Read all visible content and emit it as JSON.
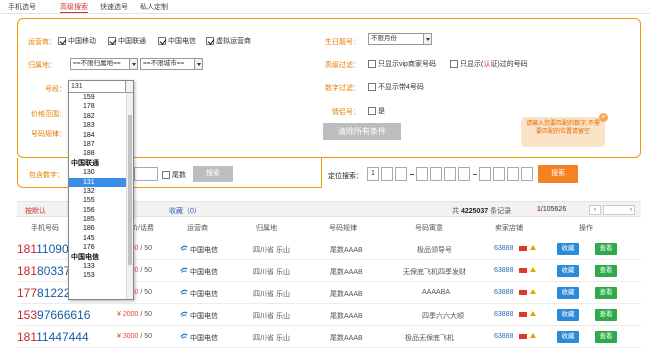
{
  "topnav": {
    "tabs": [
      "手机选号",
      "高级搜索",
      "快速选号",
      "私人定制"
    ]
  },
  "search": {
    "carrier_label": "运营商：",
    "carriers": [
      "中国移动",
      "中国联通",
      "中国电信",
      "虚拟运营商"
    ],
    "region_label": "归属地：",
    "province_placeholder": "==不限归属地==",
    "city_placeholder": "==不限城市==",
    "segment_label": "号段：",
    "segment_value": "131",
    "price_label": "价格范围：",
    "rule_label": "号码规律：",
    "birthday_label": "生日靓号：",
    "birthday_value": "不限月份",
    "advanced_label": "高级过滤：",
    "filter_vip": "只显示vip商家号码",
    "filter_cert_pre": "只显示(",
    "filter_cert_mid": "认",
    "filter_cert_post": "证)过的号码",
    "digit_label": "数字过滤：",
    "filter_no4": "不显示带4号码",
    "lovers_label": "情侣号：",
    "lovers_yes": "是",
    "clear_button": "清除所有条件",
    "tip_text": "请输入您要匹配的数字,不需要匹配的位置请留空",
    "contains_label": "包含数字：",
    "tail_label": "尾数",
    "search_button": "搜索",
    "position_label": "定位搜索：",
    "position_first": "1",
    "position_search_button": "搜索"
  },
  "sortbar": {
    "default_label": "按默认",
    "favorites": "收藏（0）",
    "total_prefix": "共",
    "total": "4225037",
    "total_suffix": "条记录",
    "page_current": "1",
    "page_total": "/105626"
  },
  "table": {
    "headers": [
      "手机号码",
      "售价/话费",
      "运营商",
      "归属地",
      "号码规律",
      "号码寓意",
      "卖家店铺",
      "操作"
    ]
  },
  "rows": [
    {
      "num_a": "181",
      "num_b": "1109",
      "num_c": "0",
      "price": "¥ 2000",
      "fee": "/ 50",
      "carrier": "中国电信",
      "region": "四川省 乐山",
      "rule": "尾数AAAB",
      "meaning": "极品领导号",
      "shop": "63888",
      "buy": "收藏",
      "view": "查看"
    },
    {
      "num_a": "181",
      "num_b": "8033",
      "num_c": "74",
      "price": "¥ 2000",
      "fee": "/ 50",
      "carrier": "中国电信",
      "region": "四川省 乐山",
      "rule": "尾数AAAB",
      "meaning": "无保底飞机四季发财",
      "shop": "63888",
      "buy": "收藏",
      "view": "查看"
    },
    {
      "num_a": "177",
      "num_b": "8122",
      "num_c": "2292",
      "price": "¥ 1200",
      "fee": "/ 50",
      "carrier": "中国电信",
      "region": "四川省 乐山",
      "rule": "尾数AAAB",
      "meaning": "AAAABA",
      "shop": "63888",
      "buy": "收藏",
      "view": "查看"
    },
    {
      "num_a": "153",
      "num_b": "9766",
      "num_c": "6616",
      "price": "¥ 2000",
      "fee": "/ 50",
      "carrier": "中国电信",
      "region": "四川省 乐山",
      "rule": "尾数AAAB",
      "meaning": "四季六六大顺",
      "shop": "63888",
      "buy": "收藏",
      "view": "查看"
    },
    {
      "num_a": "181",
      "num_b": "1144",
      "num_c": "7444",
      "price": "¥ 3000",
      "fee": "/ 50",
      "carrier": "中国电信",
      "region": "四川省 乐山",
      "rule": "尾数AAAB",
      "meaning": "极品无保底飞机",
      "shop": "63888",
      "buy": "收藏",
      "view": "查看"
    }
  ],
  "dropdown": {
    "current": "131",
    "items": [
      {
        "t": "159",
        "g": false
      },
      {
        "t": "178",
        "g": false
      },
      {
        "t": "182",
        "g": false
      },
      {
        "t": "183",
        "g": false
      },
      {
        "t": "184",
        "g": false
      },
      {
        "t": "187",
        "g": false
      },
      {
        "t": "188",
        "g": false
      },
      {
        "t": "中国联通",
        "g": true
      },
      {
        "t": "130",
        "g": false
      },
      {
        "t": "131",
        "g": false,
        "hl": true
      },
      {
        "t": "132",
        "g": false
      },
      {
        "t": "155",
        "g": false
      },
      {
        "t": "156",
        "g": false
      },
      {
        "t": "185",
        "g": false
      },
      {
        "t": "186",
        "g": false
      },
      {
        "t": "145",
        "g": false
      },
      {
        "t": "176",
        "g": false
      },
      {
        "t": "中国电信",
        "g": true
      },
      {
        "t": "133",
        "g": false
      },
      {
        "t": "153",
        "g": false
      }
    ]
  }
}
